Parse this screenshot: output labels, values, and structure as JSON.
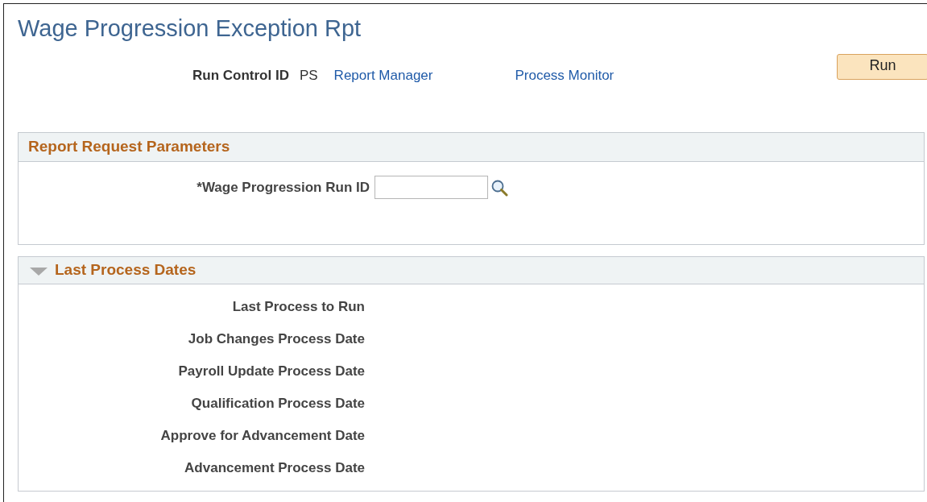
{
  "page": {
    "title": "Wage Progression Exception Rpt"
  },
  "run_control": {
    "label": "Run Control ID",
    "value": "PS",
    "links": [
      "Report Manager",
      "Process Monitor"
    ],
    "button": "Run"
  },
  "report_request_parameters": {
    "title": "Report Request Parameters",
    "field": {
      "label": "*Wage Progression Run ID"
    }
  },
  "last_process_dates": {
    "title": "Last Process Dates",
    "expanded": true,
    "fields": [
      "Last Process to Run",
      "Job Changes Process Date",
      "Payroll Update Process Date",
      "Qualification Process Date",
      "Approve for Advancement Date",
      "Advancement Process Date"
    ]
  }
}
